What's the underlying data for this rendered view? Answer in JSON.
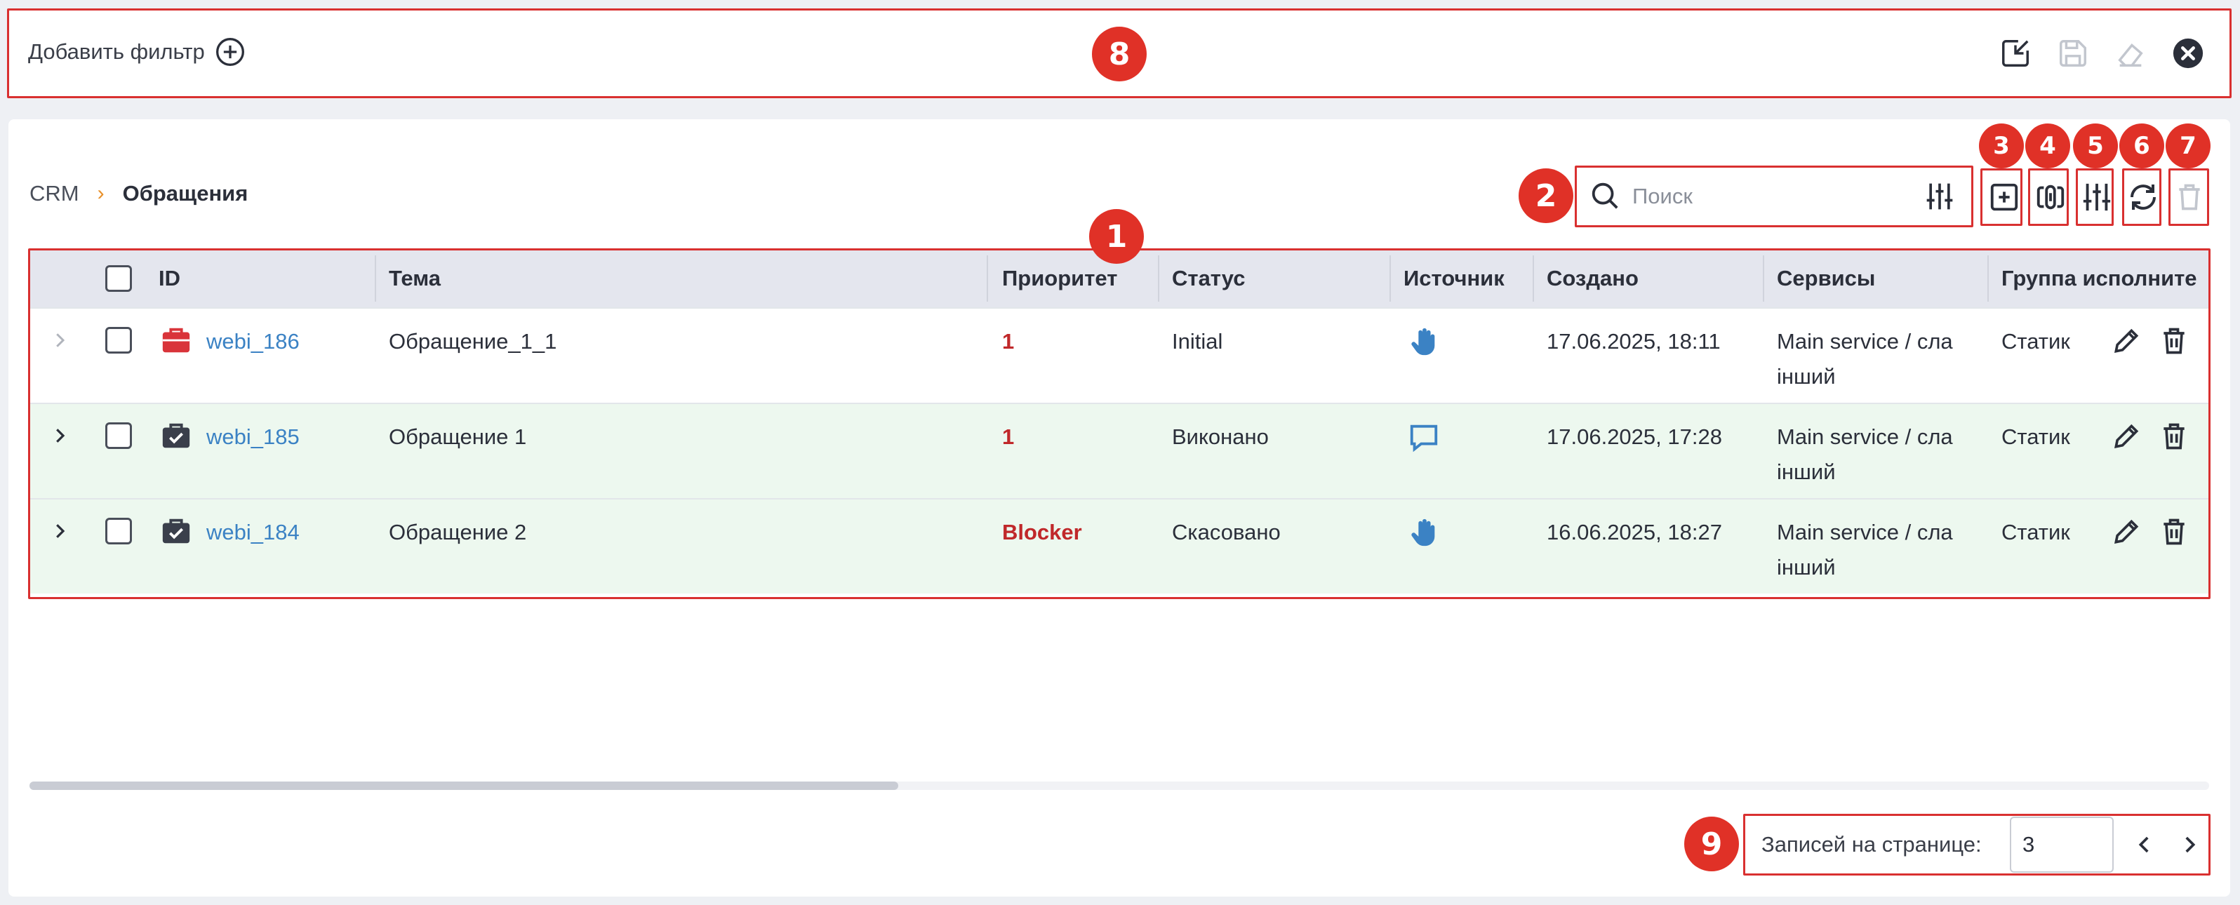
{
  "filter_bar": {
    "add_filter_label": "Добавить фильтр",
    "icons": [
      "import-icon",
      "save-icon",
      "eraser-icon",
      "close-circle-icon"
    ]
  },
  "breadcrumb": {
    "root": "CRM",
    "current": "Обращения"
  },
  "search": {
    "placeholder": "Поиск",
    "value": ""
  },
  "toolbar": {
    "icons": [
      "add-icon",
      "link-icon",
      "columns-settings-icon",
      "refresh-icon",
      "delete-icon"
    ]
  },
  "table": {
    "columns": [
      "ID",
      "Тема",
      "Приоритет",
      "Статус",
      "Источник",
      "Создано",
      "Сервисы",
      "Группа исполните"
    ],
    "rows": [
      {
        "id": "webi_186",
        "topic": "Обращение_1_1",
        "priority": "1",
        "status": "Initial",
        "source_icon": "hand-icon",
        "created": "17.06.2025, 18:11",
        "services_line1": "Main service / сла",
        "services_line2": "інший",
        "group": "Статик",
        "state_icon": "briefcase-red-icon"
      },
      {
        "id": "webi_185",
        "topic": "Обращение 1",
        "priority": "1",
        "status": "Виконано",
        "source_icon": "chat-icon",
        "created": "17.06.2025, 17:28",
        "services_line1": "Main service / сла",
        "services_line2": "інший",
        "group": "Статик",
        "state_icon": "briefcase-check-icon"
      },
      {
        "id": "webi_184",
        "topic": "Обращение 2",
        "priority": "Blocker",
        "status": "Скасовано",
        "source_icon": "hand-icon",
        "created": "16.06.2025, 18:27",
        "services_line1": "Main service / сла",
        "services_line2": "інший",
        "group": "Статик",
        "state_icon": "briefcase-check-icon"
      }
    ]
  },
  "pagination": {
    "label": "Записей на странице:",
    "page_size": "3"
  },
  "annotations": {
    "table": "1",
    "search": "2",
    "add": "3",
    "link": "4",
    "columns": "5",
    "refresh": "6",
    "delete": "7",
    "filter_bar": "8",
    "pagination": "9"
  },
  "colors": {
    "accent_link": "#3b82c4",
    "priority": "#c0282a",
    "annotation": "#e03127",
    "row_done": "#edf8ef",
    "breadcrumb_sep": "#e8902a"
  }
}
